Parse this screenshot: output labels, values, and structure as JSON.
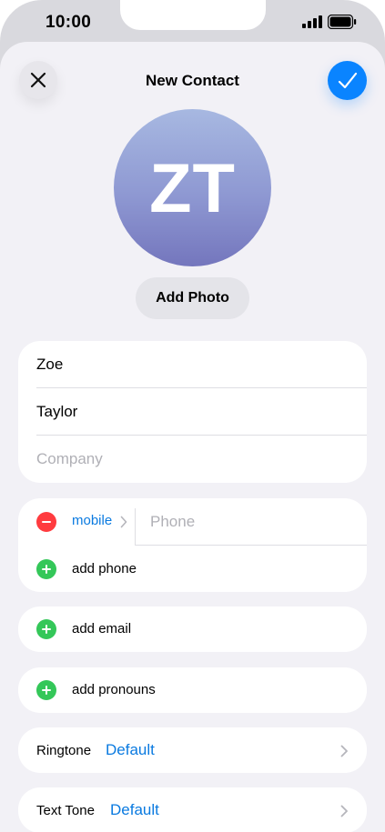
{
  "status_bar": {
    "time": "10:00"
  },
  "header": {
    "title": "New Contact",
    "close_icon": "xmark-icon",
    "done_icon": "checkmark-icon"
  },
  "avatar": {
    "initials": "ZT"
  },
  "add_photo_label": "Add Photo",
  "name_fields": {
    "first_name": "Zoe",
    "last_name": "Taylor",
    "company_placeholder": "Company"
  },
  "phone_section": {
    "label": "mobile",
    "phone_placeholder": "Phone",
    "add_phone_label": "add phone"
  },
  "add_email_label": "add email",
  "add_pronouns_label": "add pronouns",
  "ringtone": {
    "label": "Ringtone",
    "value": "Default"
  },
  "text_tone": {
    "label": "Text Tone",
    "value": "Default"
  },
  "colors": {
    "accent": "#0a84ff",
    "link": "#0a7ae0",
    "remove": "#ff3b3f",
    "add": "#34c759",
    "background": "#f2f1f6"
  }
}
